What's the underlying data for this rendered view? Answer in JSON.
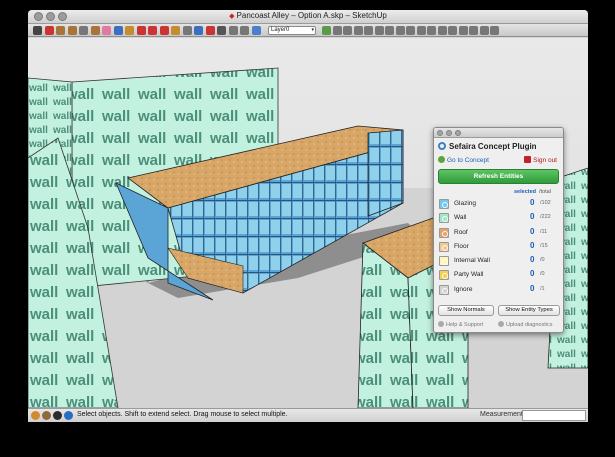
{
  "window": {
    "title": "Pancoast Alley – Option A.skp – SketchUp"
  },
  "toolbar": {
    "layer_value": "Layer0",
    "icons": [
      "select-icon",
      "pencil-icon",
      "rectangle-icon",
      "circle-icon",
      "arc-icon",
      "polygon-icon",
      "eraser-icon",
      "paint-bucket-icon",
      "push-pull-icon",
      "move-icon",
      "rotate-icon",
      "scale-icon",
      "offset-icon",
      "tape-measure-icon",
      "text-icon",
      "orbit-icon",
      "pan-icon",
      "zoom-icon",
      "zoom-extents-icon",
      "3d-warehouse-icon",
      "components-icon",
      "iso-view-icon",
      "top-view-icon",
      "front-view-icon",
      "right-view-icon",
      "back-view-icon",
      "left-view-icon",
      "xray-icon",
      "wireframe-icon",
      "hidden-line-icon",
      "shaded-icon",
      "textured-icon",
      "monochrome-icon",
      "house-icon",
      "camera-icon",
      "walk-icon",
      "section-icon"
    ]
  },
  "scene": {
    "wall_text": "wall",
    "colors": {
      "wall_fill": "#c3f1df",
      "wall_text": "#4b8e7a",
      "glass": "#5aa5d6",
      "roof": "#d8a767",
      "ground": "#d3d3d3",
      "shadow": "#8e8e8e"
    }
  },
  "status": {
    "text": "Select objects. Shift to extend select. Drag mouse to select multiple.",
    "measurements_label": "Measurements"
  },
  "plugin": {
    "title": "Sefaira Concept Plugin",
    "go_to_concept": "Go to Concept",
    "sign_out": "Sign out",
    "refresh": "Refresh Entities",
    "selected_header": "selected",
    "total_header": "/total",
    "rows": [
      {
        "label": "Glazing",
        "selected": "0",
        "total": "/102",
        "color": "#74c6ef"
      },
      {
        "label": "Wall",
        "selected": "0",
        "total": "/222",
        "color": "#9fe7c4"
      },
      {
        "label": "Roof",
        "selected": "0",
        "total": "/11",
        "color": "#e2a469"
      },
      {
        "label": "Floor",
        "selected": "0",
        "total": "/15",
        "color": "#f3c591"
      },
      {
        "label": "Internal Wall",
        "selected": "0",
        "total": "/0",
        "color": "#fff3b5"
      },
      {
        "label": "Party Wall",
        "selected": "0",
        "total": "/0",
        "color": "#f6cf52"
      },
      {
        "label": "Ignore",
        "selected": "0",
        "total": "/1",
        "color": "#d2d2d2"
      }
    ],
    "show_normals": "Show Normals",
    "show_entity_types": "Show Entity Types",
    "help_support": "Help & Support",
    "upload_diagnostics": "Upload diagnostics"
  }
}
